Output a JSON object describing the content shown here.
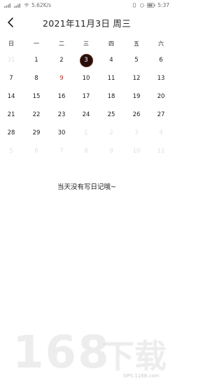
{
  "status_bar": {
    "speed": "5.62K/s",
    "time": "5:37"
  },
  "header": {
    "title": "2021年11月3日  周三"
  },
  "weekdays": [
    "日",
    "一",
    "二",
    "三",
    "四",
    "五",
    "六"
  ],
  "days": [
    [
      "31",
      "1",
      "2",
      "3",
      "4",
      "5",
      "6"
    ],
    [
      "7",
      "8",
      "9",
      "10",
      "11",
      "12",
      "13"
    ],
    [
      "14",
      "15",
      "16",
      "17",
      "18",
      "19",
      "20"
    ],
    [
      "21",
      "22",
      "23",
      "24",
      "25",
      "26",
      "27"
    ],
    [
      "28",
      "29",
      "30",
      "1",
      "2",
      "3",
      "4"
    ],
    [
      "5",
      "6",
      "7",
      "8",
      "9",
      "10",
      "11"
    ]
  ],
  "muted": [
    [
      0,
      0
    ],
    [
      4,
      3
    ],
    [
      4,
      4
    ],
    [
      4,
      5
    ],
    [
      4,
      6
    ],
    [
      5,
      0
    ],
    [
      5,
      1
    ],
    [
      5,
      2
    ],
    [
      5,
      3
    ],
    [
      5,
      4
    ],
    [
      5,
      5
    ],
    [
      5,
      6
    ]
  ],
  "selected": [
    0,
    3
  ],
  "empty_message": "当天没有写日记哦~",
  "watermark": {
    "text": "168下载",
    "sub": "GPS:1168.com"
  },
  "colors": {
    "selected_bg": "#2a0e0b",
    "red_text": "#b53a30",
    "muted": "#e0e0e0"
  }
}
